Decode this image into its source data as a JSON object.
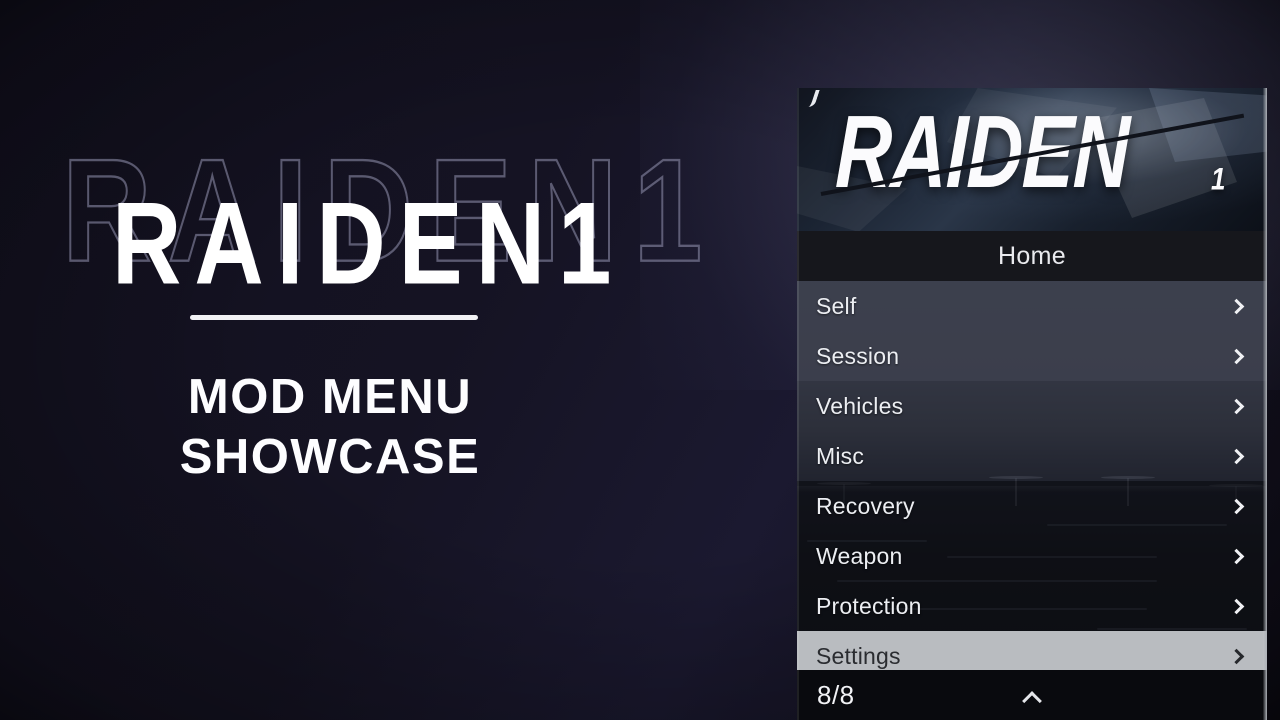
{
  "hero": {
    "title": "RAIDEN1",
    "ghost_title": "RAIDEN1",
    "subtitle_line1": "MOD MENU",
    "subtitle_line2": "SHOWCASE"
  },
  "menu": {
    "banner_logo": "RAIDEN",
    "banner_superscript": "1",
    "header_title": "Home",
    "items": [
      {
        "label": "Self",
        "chevron": "chevron-right-icon",
        "selected": false
      },
      {
        "label": "Session",
        "chevron": "chevron-right-icon",
        "selected": false
      },
      {
        "label": "Vehicles",
        "chevron": "chevron-right-icon",
        "selected": false
      },
      {
        "label": "Misc",
        "chevron": "chevron-right-icon",
        "selected": false
      },
      {
        "label": "Recovery",
        "chevron": "chevron-right-icon",
        "selected": false
      },
      {
        "label": "Weapon",
        "chevron": "chevron-right-icon",
        "selected": false
      },
      {
        "label": "Protection",
        "chevron": "chevron-right-icon",
        "selected": false
      },
      {
        "label": "Settings",
        "chevron": "chevron-right-icon",
        "selected": true
      }
    ],
    "footer": {
      "counter": "8/8",
      "scroll_icon": "chevron-up-icon"
    }
  },
  "colors": {
    "page_background": "#141222",
    "panel_background": "#23232e",
    "header_bar": "#16171c",
    "selected_row": "#b9bcc0",
    "selected_row_text": "#2a2c30",
    "row_text": "#eceef2",
    "footer_bar": "#090a0e",
    "accent_white": "#ffffff"
  }
}
